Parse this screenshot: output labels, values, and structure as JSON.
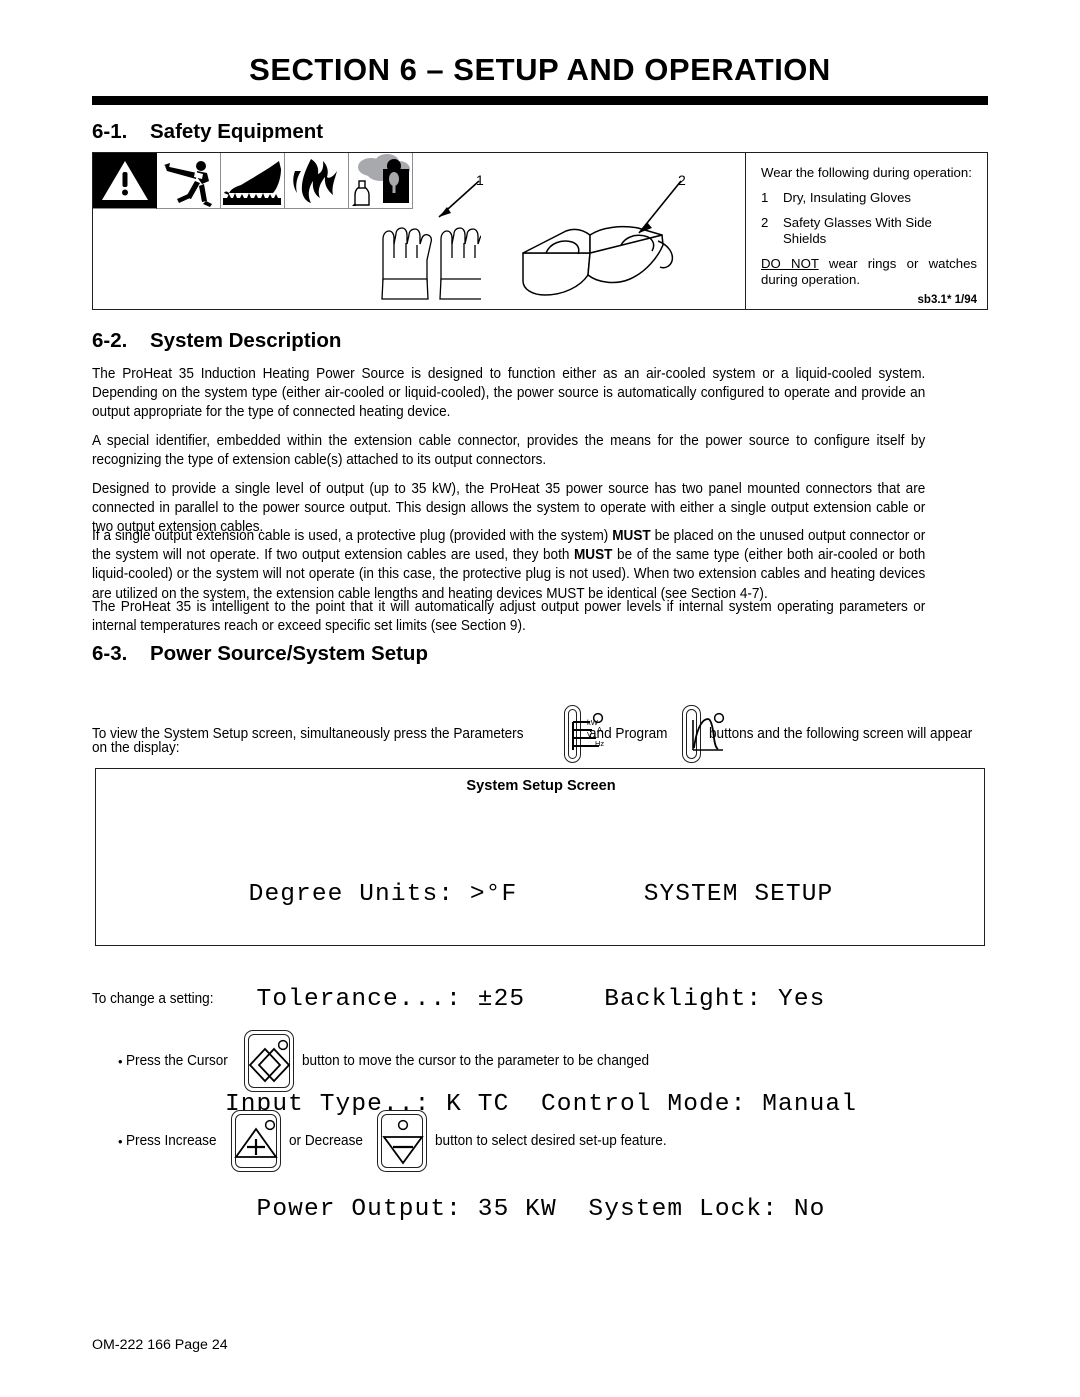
{
  "document": {
    "section_title": "SECTION 6 – SETUP AND OPERATION",
    "footer": "OM-222 166 Page 24"
  },
  "sections": {
    "s61": {
      "number": "6-1.",
      "title": "Safety Equipment"
    },
    "s62": {
      "number": "6-2.",
      "title": "System Description"
    },
    "s63": {
      "number": "6-3.",
      "title": "Power Source/System Setup"
    }
  },
  "safety": {
    "icons": [
      "warning-triangle-icon",
      "electric-shock-icon",
      "hot-surface-hand-icon",
      "fire-icon",
      "fumes-gas-icon"
    ],
    "callouts": [
      "1",
      "2"
    ],
    "intro": "Wear the following during operation:",
    "items": [
      {
        "num": "1",
        "text": "Dry, Insulating Gloves"
      },
      {
        "num": "2",
        "text": "Safety Glasses With Side Shields"
      }
    ],
    "warning_prefix": "DO NOT",
    "warning_rest": " wear rings or watches during operation.",
    "doc_code": "sb3.1* 1/94"
  },
  "body": {
    "p1": "The ProHeat 35 Induction Heating Power Source is designed to function either as an air-cooled system or a liquid-cooled system. Depending on the system type (either air-cooled or liquid-cooled), the power source is automatically configured to operate and provide an output appropriate for the type of connected heating device.",
    "p2": "A special identifier, embedded within the extension cable connector, provides the means for the power source to configure itself by recognizing the type of extension cable(s) attached to its output connectors.",
    "p3": "Designed to provide a single level of output (up to 35 kW), the ProHeat 35 power source has two panel mounted connectors that are connected in parallel to the power source output. This design allows the system to operate with either a single output extension cable or two output extension cables.",
    "p4_a": "If a single output extension cable is used, a protective plug (provided with the system) ",
    "p4_b": "MUST",
    "p4_c": " be placed on the unused output connector or the system will not operate. If two output extension cables are used, they both ",
    "p4_d": "MUST",
    "p4_e": " be of the same type (either both air-cooled or both liquid-cooled) or the system will not operate (in this case, the protective plug is not used). When two extension cables and heating devices are utilized on the system, the extension cable lengths and heating devices MUST be identical (see Section 4-7).",
    "p5": "The ProHeat 35 is intelligent to the point that it will automatically adjust output power levels if internal system operating parameters or internal temperatures reach or exceed specific set limits (see Section 9)."
  },
  "setup_intro": {
    "part1": "To view the System Setup screen, simultaneously press the Parameters",
    "part2": "and Program",
    "part3": "buttons and the following screen will appear",
    "part4": "on the display:",
    "parameters_button_labels": [
      "kW",
      "A",
      "V",
      "Hz"
    ]
  },
  "screen": {
    "caption": "System Setup Screen",
    "lines": [
      "Degree Units: >°F        SYSTEM SETUP",
      "Tolerance...: ±25     Backlight: Yes",
      "Input Type..: K TC  Control Mode: Manual",
      "Power Output: 35 KW  System Lock: No"
    ],
    "fields": {
      "degree_units": ">°F",
      "tolerance": "±25",
      "input_type": "K TC",
      "power_output": "35 KW",
      "title": "SYSTEM SETUP",
      "backlight": "Yes",
      "control_mode": "Manual",
      "system_lock": "No"
    }
  },
  "change_setting": {
    "lead": "To change a setting:",
    "bullet": "•",
    "row1_a": "Press the Cursor",
    "row1_b": "button to move the cursor to the parameter to be changed",
    "row2_a": "Press Increase",
    "row2_b": "or Decrease",
    "row2_c": "button to select desired set-up feature."
  },
  "colors": {
    "ink": "#000000",
    "rule": "#231f20",
    "icon_border": "#8d8d8d",
    "gray_fill": "#a7a9ac"
  }
}
